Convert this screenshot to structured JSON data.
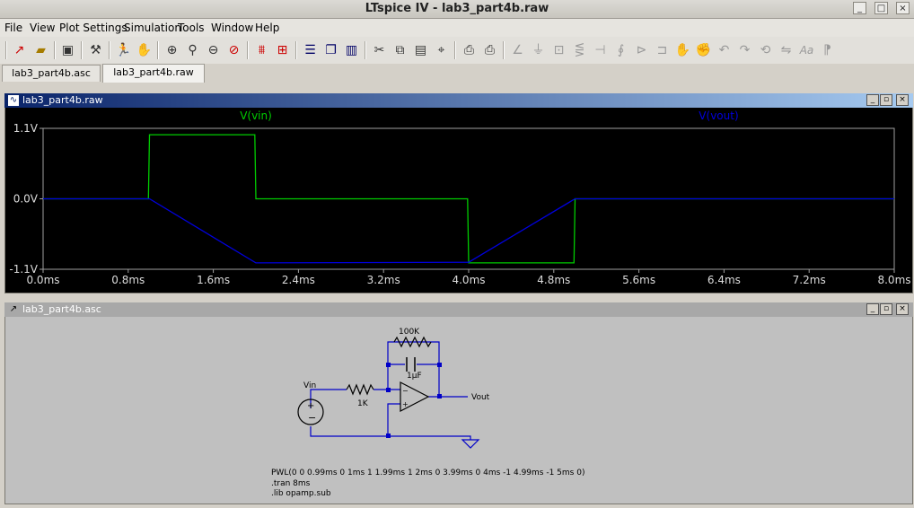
{
  "window": {
    "title": "LTspice IV - lab3_part4b.raw",
    "buttons": [
      "_",
      "□",
      "×"
    ]
  },
  "menu": [
    "File",
    "View",
    "Plot Settings",
    "Simulation",
    "Tools",
    "Window",
    "Help"
  ],
  "tabs": [
    {
      "label": "lab3_part4b.asc",
      "active": false
    },
    {
      "label": "lab3_part4b.raw",
      "active": true
    }
  ],
  "plot_window": {
    "title": "lab3_part4b.raw",
    "background": "#000000",
    "chart_data": {
      "type": "line",
      "title": "",
      "xlabel": "",
      "ylabel": "",
      "xlim": [
        0,
        8
      ],
      "ylim": [
        -1.1,
        1.1
      ],
      "x_unit": "ms",
      "x_ticks": [
        "0.0ms",
        "0.8ms",
        "1.6ms",
        "2.4ms",
        "3.2ms",
        "4.0ms",
        "4.8ms",
        "5.6ms",
        "6.4ms",
        "7.2ms",
        "8.0ms"
      ],
      "y_ticks": [
        "1.1V",
        "0.0V",
        "-1.1V"
      ],
      "series": [
        {
          "name": "V(vin)",
          "color": "#00cc00",
          "x": [
            0,
            0.99,
            1.0,
            1.99,
            2.0,
            3.99,
            4.0,
            4.99,
            5.0,
            8.0
          ],
          "y": [
            0,
            0,
            1.0,
            1.0,
            0,
            0,
            -1.0,
            -1.0,
            0,
            0
          ]
        },
        {
          "name": "V(vout)",
          "color": "#0000dd",
          "x": [
            0,
            1.0,
            2.0,
            4.0,
            5.0,
            8.0
          ],
          "y": [
            0,
            0,
            -1.0,
            -0.99,
            0,
            0
          ]
        }
      ]
    }
  },
  "schematic_window": {
    "title": "lab3_part4b.asc",
    "labels": {
      "r_feedback": "100K",
      "c_feedback": "1µF",
      "r_input": "1K",
      "source_label": "Vin",
      "output_label": "Vout"
    },
    "directives": [
      "PWL(0 0 0.99ms 0 1ms 1 1.99ms 1 2ms 0 3.99ms 0 4ms -1 4.99ms -1 5ms 0)",
      ".tran 8ms",
      ".lib opamp.sub"
    ]
  },
  "icons": [
    "new-schematic-icon",
    "open-icon",
    "save-icon",
    "control-panel-icon",
    "run-icon",
    "halt-icon",
    "zoom-in-icon",
    "zoom-full-icon",
    "zoom-out-icon",
    "zoom-cancel-icon",
    "autoscale-icon",
    "pick-traces-icon",
    "tile-horizontal-icon",
    "cascade-icon",
    "tile-vertical-icon",
    "cut-icon",
    "copy-icon",
    "paste-icon",
    "find-icon",
    "print-setup-icon",
    "print-icon",
    "wire-icon",
    "ground-icon",
    "label-icon",
    "resistor-icon",
    "capacitor-icon",
    "inductor-icon",
    "diode-icon",
    "component-icon",
    "move-icon",
    "drag-icon",
    "undo-icon",
    "redo-icon",
    "rotate-icon",
    "mirror-icon",
    "text-icon",
    "spice-directive-icon"
  ]
}
